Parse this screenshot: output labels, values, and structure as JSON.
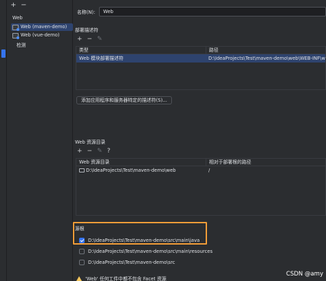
{
  "toolbar": {
    "add": "+",
    "remove": "−"
  },
  "sidebar": {
    "heading": "Web",
    "items": [
      {
        "label": "Web (maven-demo)",
        "selected": true
      },
      {
        "label": "Web (vue-demo)",
        "selected": false
      }
    ],
    "detect_label": "检测"
  },
  "main": {
    "name_label": "名称(N):",
    "name_value": "Web",
    "deploy": {
      "title": "部署描述符",
      "toolbar": [
        "+",
        "−",
        "✎"
      ],
      "columns": [
        "类型",
        "路径"
      ],
      "rows": [
        {
          "type": "Web 模块部署描述符",
          "path": "D:\\IdeaProjects\\Test\\maven-demo\\web\\WEB-INF\\web.xml"
        }
      ],
      "add_button": "添加应用程序和服务器特定的描述符(S)..."
    },
    "resources": {
      "title": "Web 资源目录",
      "toolbar": [
        "+",
        "−",
        "✎",
        "?"
      ],
      "columns": [
        "Web 资源目录",
        "相对于部署根的路径"
      ],
      "rows": [
        {
          "dir": "D:\\IdeaProjects\\Test\\maven-demo\\web",
          "relative": "/"
        }
      ]
    },
    "source_roots": {
      "title": "源根",
      "items": [
        {
          "path": "D:\\IdeaProjects\\Test\\maven-demo\\src\\main\\java",
          "checked": true
        },
        {
          "path": "D:\\IdeaProjects\\Test\\maven-demo\\src\\main\\resources",
          "checked": false
        },
        {
          "path": "D:\\IdeaProjects\\Test\\maven-demo\\src",
          "checked": false
        }
      ]
    },
    "warning": "'Web' 任何工件中都不包含 Facet 资源"
  },
  "watermark": "CSDN @amy"
}
